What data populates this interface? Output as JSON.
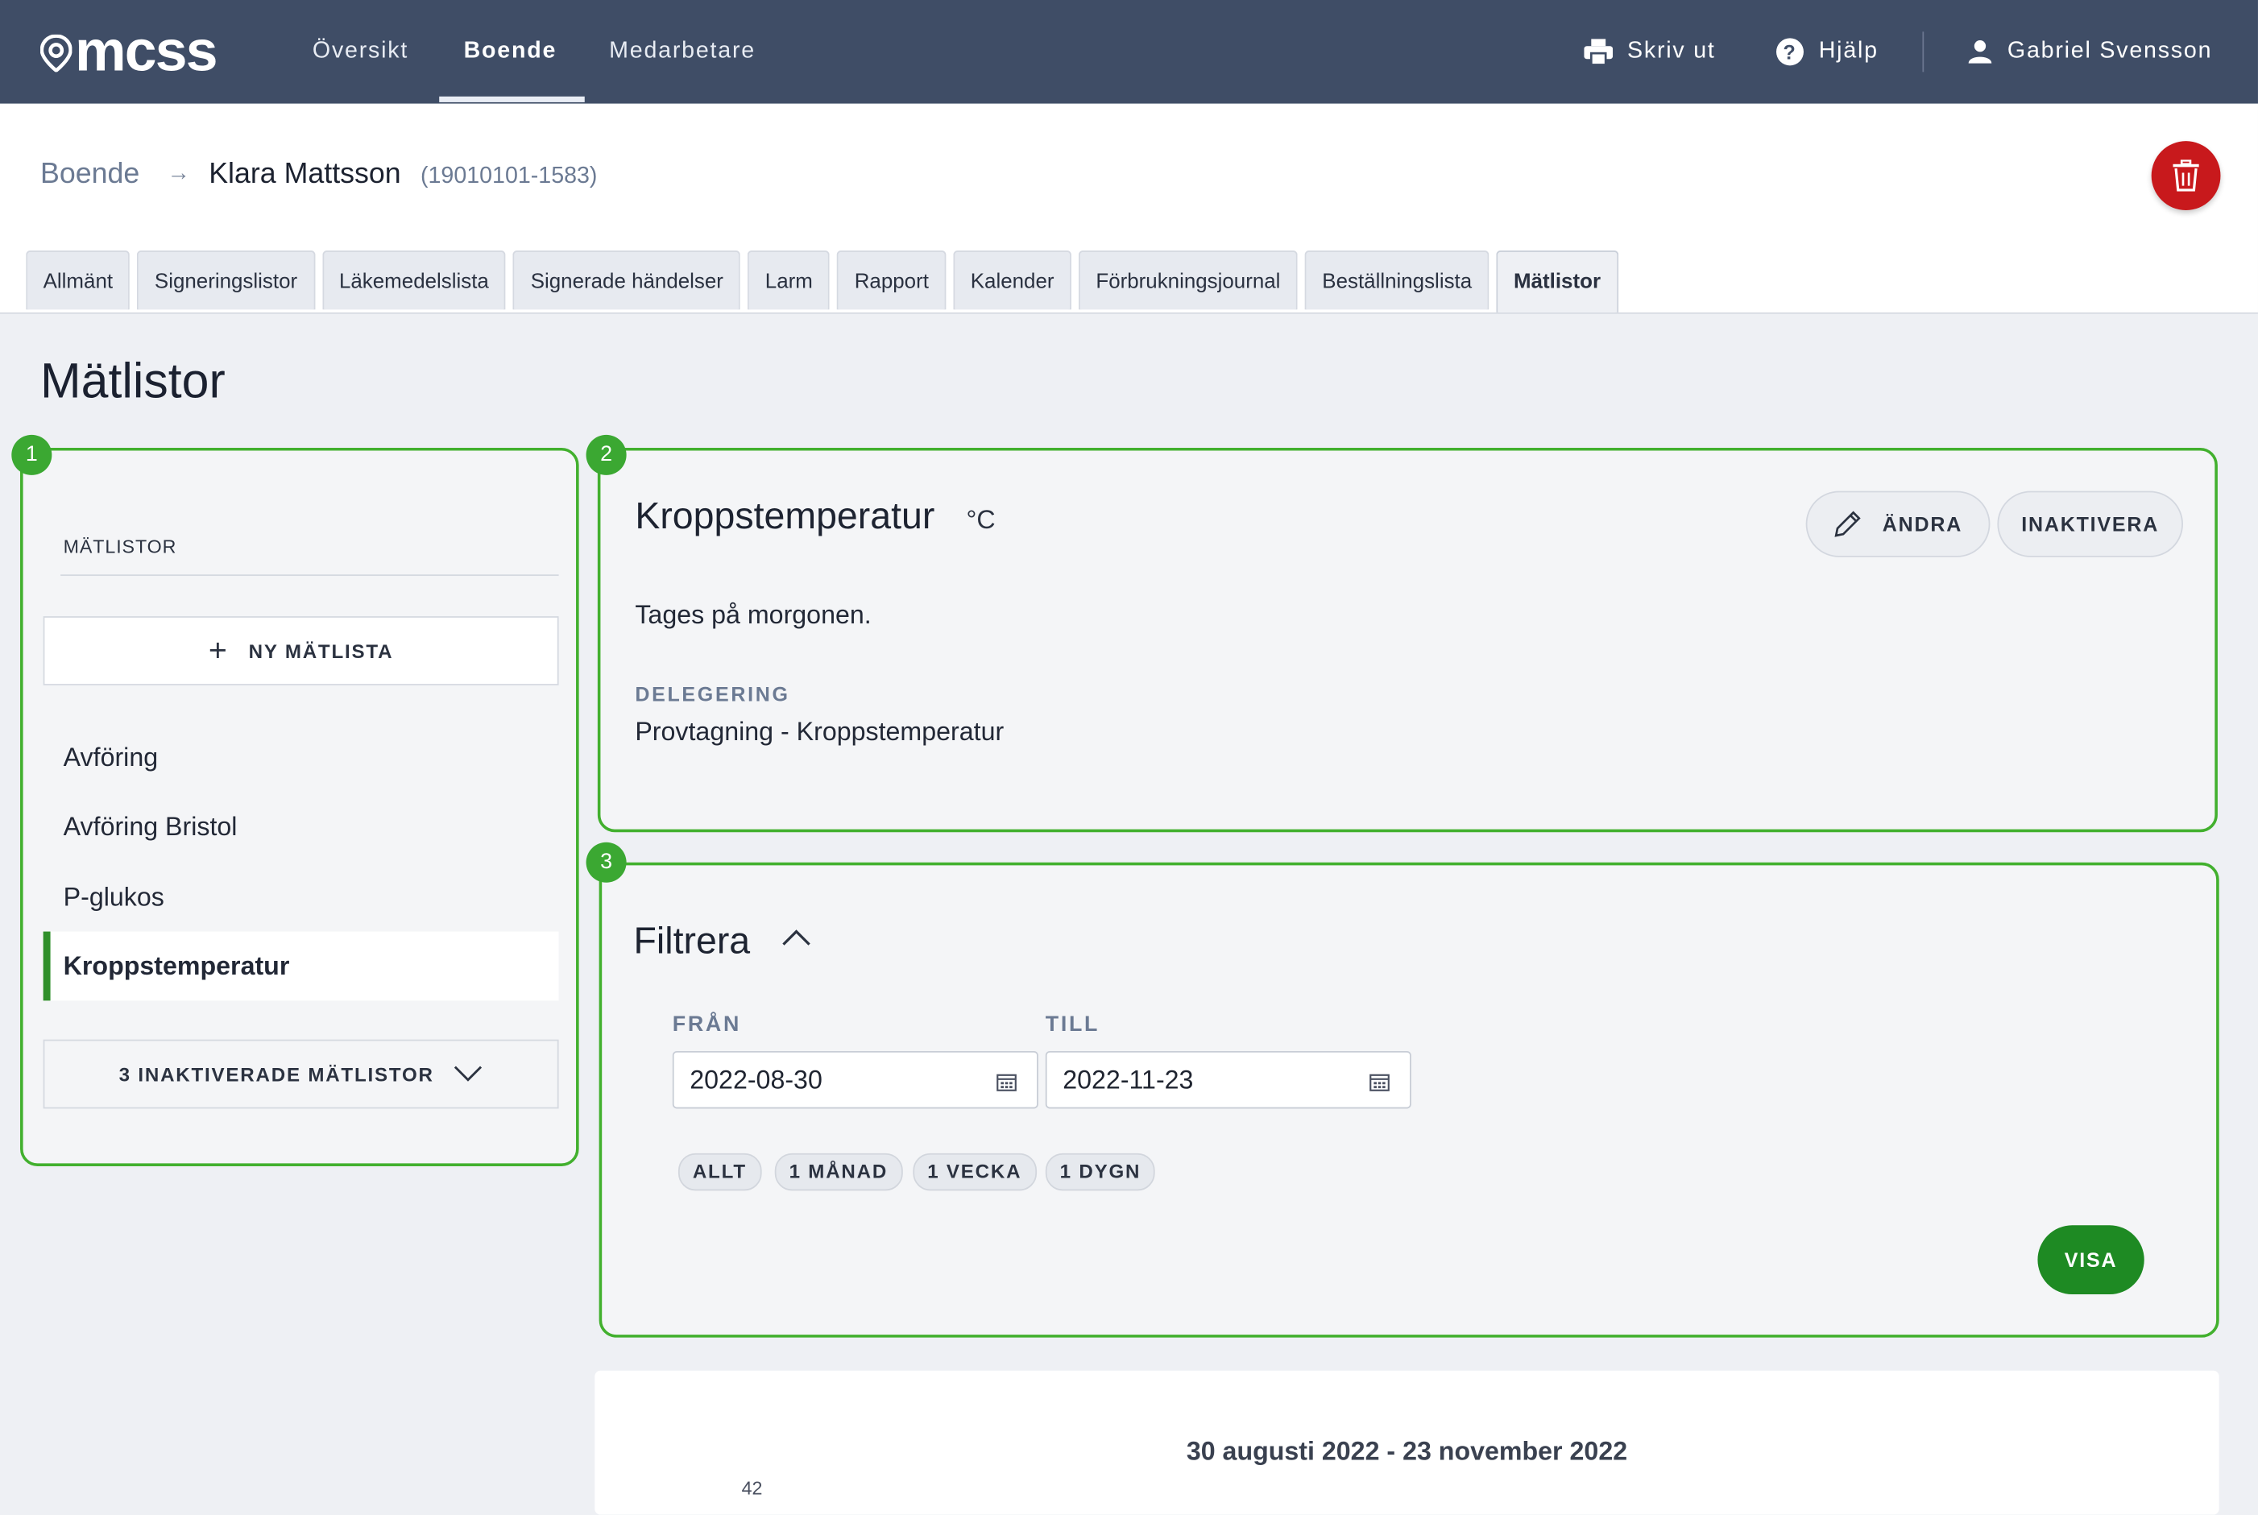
{
  "app": {
    "logo": "mcss",
    "nav": [
      {
        "label": "Översikt"
      },
      {
        "label": "Boende"
      },
      {
        "label": "Medarbetare"
      }
    ],
    "print_label": "Skriv ut",
    "help_label": "Hjälp",
    "user_name": "Gabriel Svensson"
  },
  "breadcrumb": {
    "root": "Boende",
    "separator": "→",
    "name": "Klara Mattsson",
    "personal_id": "(19010101-1583)"
  },
  "tabs": [
    {
      "label": "Allmänt"
    },
    {
      "label": "Signeringslistor"
    },
    {
      "label": "Läkemedelslista"
    },
    {
      "label": "Signerade händelser"
    },
    {
      "label": "Larm"
    },
    {
      "label": "Rapport"
    },
    {
      "label": "Kalender"
    },
    {
      "label": "Förbrukningsjournal"
    },
    {
      "label": "Beställningslista"
    },
    {
      "label": "Mätlistor"
    }
  ],
  "page_title": "Mätlistor",
  "badges": [
    "1",
    "2",
    "3"
  ],
  "sidebar": {
    "heading": "MÄTLISTOR",
    "new_button": "NY MÄTLISTA",
    "items": [
      {
        "label": "Avföring"
      },
      {
        "label": "Avföring Bristol"
      },
      {
        "label": "P-glukos"
      },
      {
        "label": "Kroppstemperatur"
      }
    ],
    "inactive_button": "3 INAKTIVERADE MÄTLISTOR"
  },
  "detail": {
    "title": "Kroppstemperatur",
    "unit": "°C",
    "edit_label": "ÄNDRA",
    "deactivate_label": "INAKTIVERA",
    "description": "Tages på morgonen.",
    "delegation_label": "DELEGERING",
    "delegation_value": "Provtagning - Kroppstemperatur"
  },
  "filter": {
    "title": "Filtrera",
    "from_label": "FRÅN",
    "to_label": "TILL",
    "from_value": "2022-08-30",
    "to_value": "2022-11-23",
    "quick": [
      "ALLT",
      "1 MÅNAD",
      "1 VECKA",
      "1 DYGN"
    ],
    "show_button": "VISA"
  },
  "result": {
    "range": "30 augusti 2022 - 23 november 2022",
    "axis_label": "42"
  },
  "colors": {
    "topbar": "#3f4d66",
    "accent_green": "#1e8a23",
    "panel_outline": "#42b02e",
    "delete_red": "#c8191c"
  }
}
